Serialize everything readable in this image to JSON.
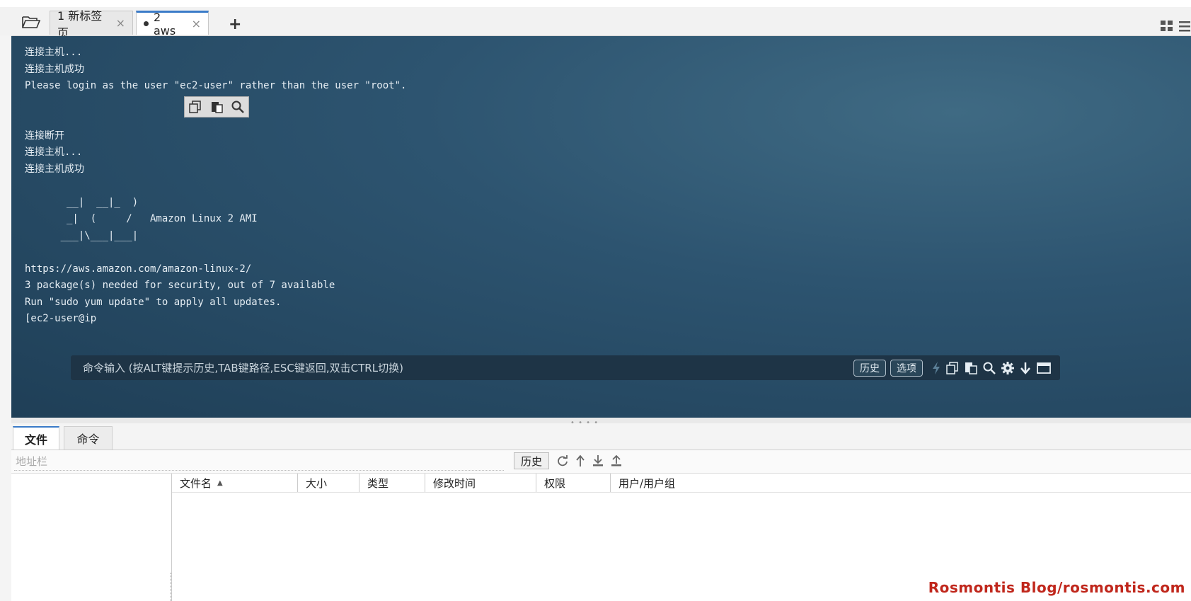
{
  "tabs": [
    {
      "label": "1 新标签页",
      "close": "×",
      "active": false,
      "modified": false
    },
    {
      "label": "2 aws",
      "close": "×",
      "active": true,
      "modified": true
    }
  ],
  "new_tab_label": "+",
  "terminal": {
    "lines": [
      "连接主机...",
      "连接主机成功",
      "Please login as the user \"ec2-user\" rather than the user \"root\".",
      "",
      "",
      "连接断开",
      "连接主机...",
      "连接主机成功",
      "",
      "       __|  __|_  )",
      "       _|  (     /   Amazon Linux 2 AMI",
      "      ___|\\___|___|",
      "",
      "https://aws.amazon.com/amazon-linux-2/",
      "3 package(s) needed for security, out of 7 available",
      "Run \"sudo yum update\" to apply all updates.",
      "[ec2-user@ip"
    ]
  },
  "command_bar": {
    "hint": "命令输入 (按ALT键提示历史,TAB键路径,ESC键返回,双击CTRL切换)",
    "history_label": "历史",
    "options_label": "选项"
  },
  "bottom_tabs": [
    {
      "label": "文件",
      "active": true
    },
    {
      "label": "命令",
      "active": false
    }
  ],
  "address_bar": {
    "placeholder": "地址栏",
    "history_label": "历史"
  },
  "file_table": {
    "columns": [
      "文件名",
      "大小",
      "类型",
      "修改时间",
      "权限",
      "用户/用户组"
    ],
    "sort_indicator": "▲"
  },
  "watermark": "Rosmontis  Blog/rosmontis.com",
  "colors": {
    "accent": "#3a7bc8",
    "terminal_bg": "#2d5470",
    "watermark": "#c0271c"
  }
}
